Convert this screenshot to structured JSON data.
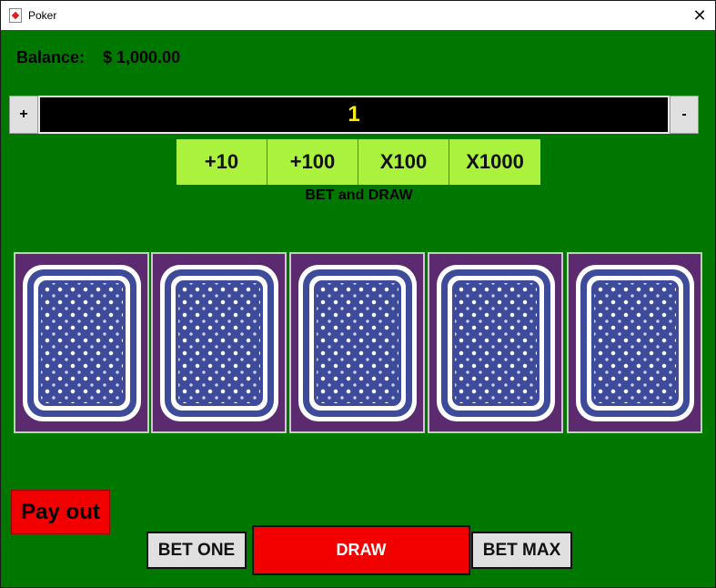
{
  "window": {
    "title": "Poker",
    "close_glyph": "✕"
  },
  "balance": {
    "label": "Balance:",
    "value": "$ 1,000.00"
  },
  "bet": {
    "plus_label": "+",
    "minus_label": "-",
    "amount": "1"
  },
  "quick_bets": [
    {
      "label": "+10"
    },
    {
      "label": "+100"
    },
    {
      "label": "X100"
    },
    {
      "label": "X1000"
    }
  ],
  "bet_and_draw_label": "BET and DRAW",
  "cards": [
    {
      "face": "back"
    },
    {
      "face": "back"
    },
    {
      "face": "back"
    },
    {
      "face": "back"
    },
    {
      "face": "back"
    }
  ],
  "buttons": {
    "payout": "Pay out",
    "bet_one": "BET ONE",
    "draw": "DRAW",
    "bet_max": "BET MAX"
  },
  "colors": {
    "table": "#007800",
    "bet_text": "#f7ea1a",
    "quick_bg": "#aaf23e",
    "draw_bg": "#f20000",
    "card_back": "#5c2a6e"
  }
}
